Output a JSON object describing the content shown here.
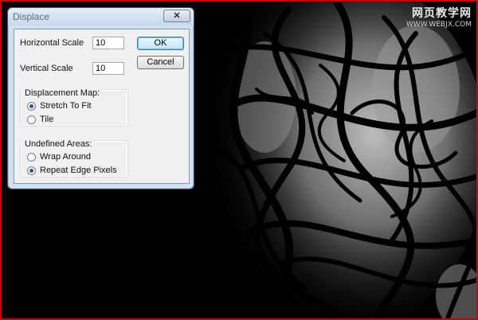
{
  "watermark": {
    "line1": "网页教学网",
    "line2": "WWW.WEBJX.COM"
  },
  "dialog": {
    "title": "Displace",
    "close_glyph": "✕",
    "horizontal_scale": {
      "label": "Horizontal Scale",
      "value": "10"
    },
    "vertical_scale": {
      "label": "Vertical Scale",
      "value": "10"
    },
    "ok_label": "OK",
    "cancel_label": "Cancel",
    "displacement_map": {
      "title": "Displacement Map:",
      "options": [
        {
          "label": "Stretch To Fit",
          "selected": true
        },
        {
          "label": "Tile",
          "selected": false
        }
      ]
    },
    "undefined_areas": {
      "title": "Undefined Areas:",
      "options": [
        {
          "label": "Wrap Around",
          "selected": false
        },
        {
          "label": "Repeat Edge Pixels",
          "selected": true
        }
      ]
    }
  },
  "colors": {
    "border": "#d00000",
    "canvas": "#000000",
    "dialog_frame": "#cfe1f2",
    "radio_dot": "#1f5ea8"
  }
}
